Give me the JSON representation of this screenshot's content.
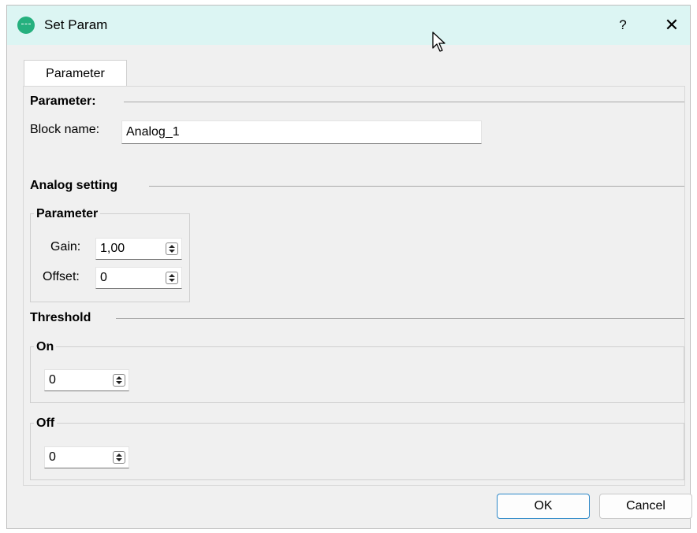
{
  "window": {
    "title": "Set Param",
    "help": "?",
    "close": "✕"
  },
  "tab": {
    "label": "Parameter"
  },
  "parameter_section": {
    "title": "Parameter:",
    "block_name_label": "Block name:",
    "block_name_value": "Analog_1"
  },
  "analog_section": {
    "title": "Analog setting",
    "group_title": "Parameter",
    "gain_label": "Gain:",
    "gain_value": "1,00",
    "offset_label": "Offset:",
    "offset_value": "0"
  },
  "threshold_section": {
    "title": "Threshold",
    "on_title": "On",
    "on_value": "0",
    "off_title": "Off",
    "off_value": "0"
  },
  "buttons": {
    "ok": "OK",
    "cancel": "Cancel"
  }
}
